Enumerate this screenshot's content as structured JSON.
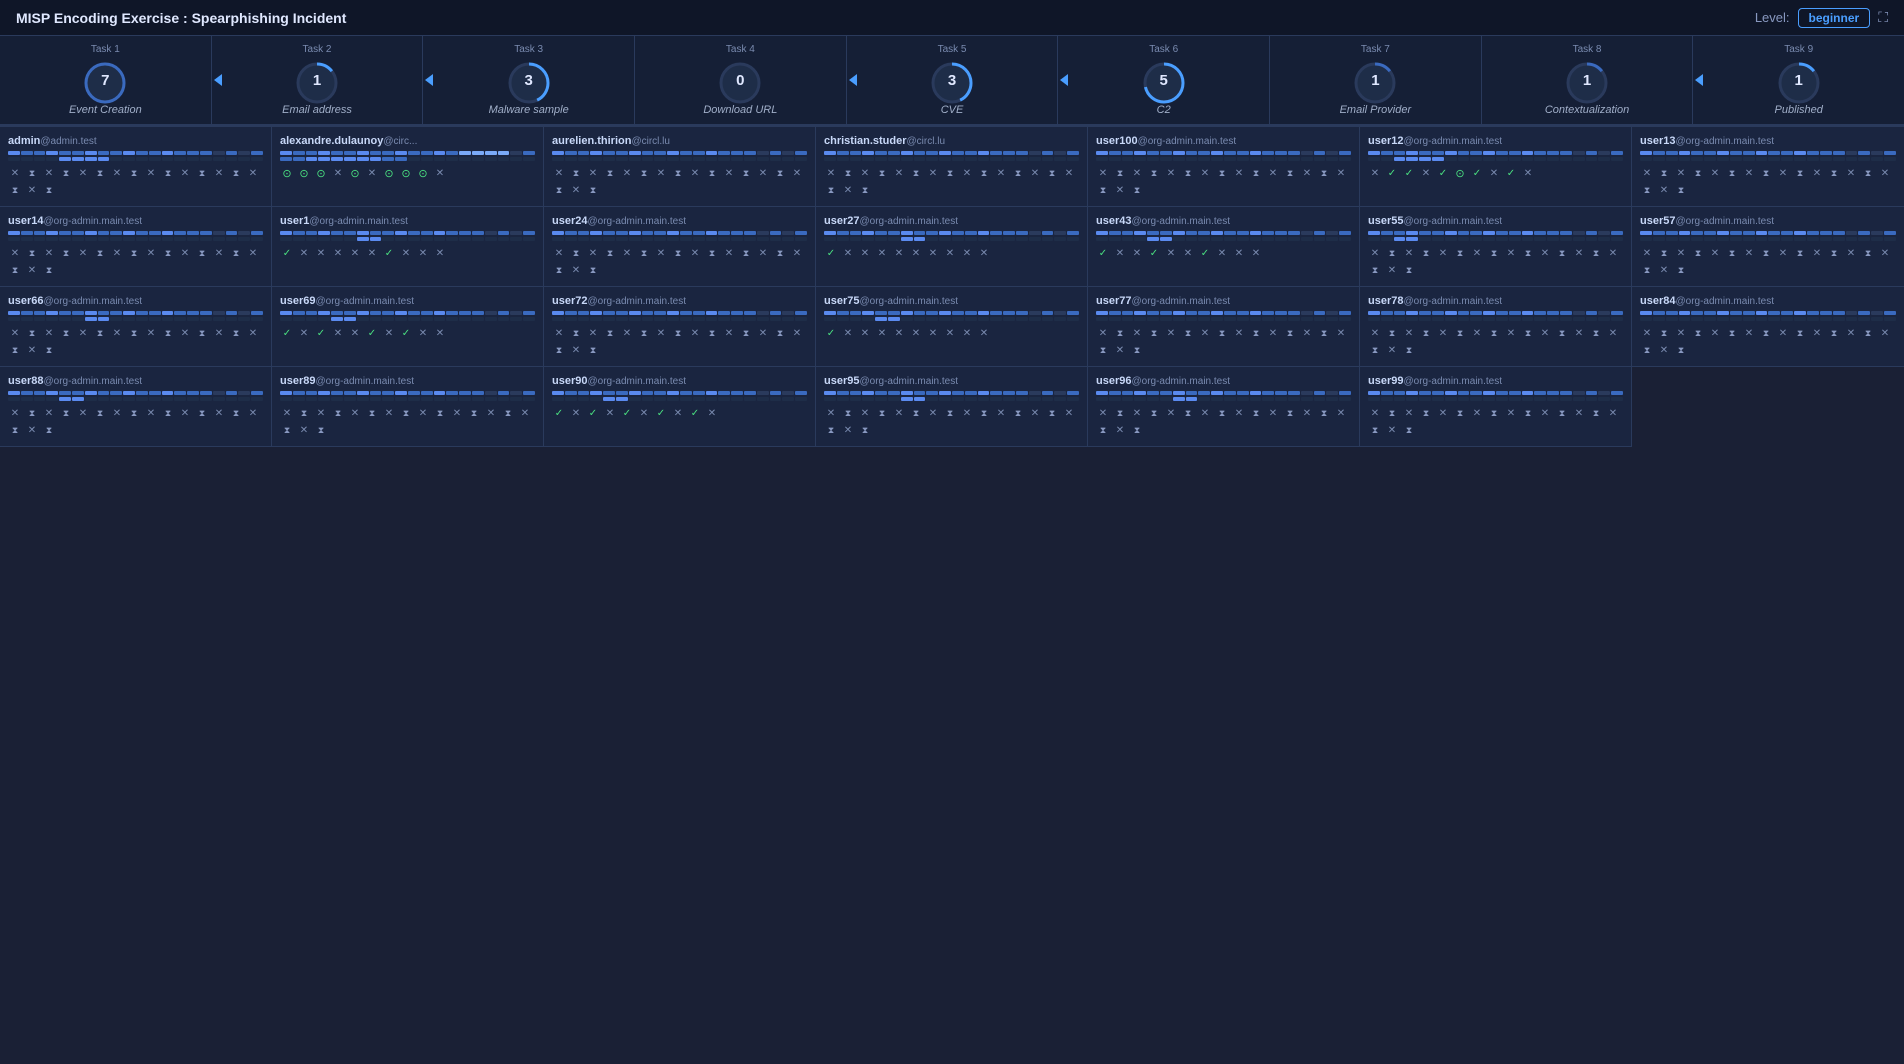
{
  "header": {
    "title": "MISP Encoding Exercise : Spearphishing Incident",
    "level_label": "Level:",
    "level_value": "beginner"
  },
  "tasks": [
    {
      "num": "Task 1",
      "sub": "Event Creation",
      "count": 7,
      "active": true,
      "arrow": false
    },
    {
      "num": "Task 2",
      "sub": "Email address",
      "count": 1,
      "active": false,
      "arrow": true
    },
    {
      "num": "Task 3",
      "sub": "Malware sample",
      "count": 3,
      "active": false,
      "arrow": true
    },
    {
      "num": "Task 4",
      "sub": "Download URL",
      "count": 0,
      "active": false,
      "arrow": false
    },
    {
      "num": "Task 5",
      "sub": "CVE",
      "count": 3,
      "active": false,
      "arrow": true
    },
    {
      "num": "Task 6",
      "sub": "C2",
      "count": 5,
      "active": false,
      "arrow": true
    },
    {
      "num": "Task 7",
      "sub": "Email Provider",
      "count": 1,
      "active": false,
      "arrow": false
    },
    {
      "num": "Task 8",
      "sub": "Contextualization",
      "count": 1,
      "active": false,
      "arrow": false
    },
    {
      "num": "Task 9",
      "sub": "Published",
      "count": 1,
      "active": false,
      "arrow": true
    }
  ],
  "users": [
    {
      "name": "admin",
      "domain": "@admin.test",
      "bars": [
        [
          1,
          1,
          1,
          1,
          1,
          1,
          1,
          1,
          1,
          0
        ],
        [
          0,
          0,
          1,
          1,
          0,
          0,
          0,
          1,
          0,
          0
        ]
      ],
      "icons": [
        "x",
        "h",
        "x",
        "h",
        "x",
        "h",
        "x",
        "h",
        "x",
        "h",
        "x",
        "h",
        "x",
        "h",
        "x",
        "h",
        "x",
        "h"
      ]
    },
    {
      "name": "alexandre.dulaunoy",
      "domain": "@circ...",
      "bars": [
        [
          1,
          1,
          1,
          1,
          1,
          1,
          1,
          1,
          1,
          1
        ],
        [
          0,
          1,
          1,
          1,
          0,
          0,
          1,
          1,
          1,
          0
        ]
      ],
      "icons": [
        "cc",
        "cc",
        "cc",
        "x",
        "cc",
        "x",
        "cc",
        "cc",
        "cc",
        "x"
      ]
    },
    {
      "name": "aurelien.thirion",
      "domain": "@circl.lu",
      "bars": [
        [
          1,
          1,
          1,
          1,
          1,
          1,
          1,
          1,
          1,
          1
        ],
        [
          0,
          0,
          0,
          0,
          0,
          0,
          0,
          0,
          0,
          0
        ]
      ],
      "icons": [
        "x",
        "h",
        "x",
        "h",
        "x",
        "h",
        "x",
        "h",
        "x",
        "h",
        "x",
        "h",
        "x",
        "h",
        "x",
        "h",
        "x",
        "h"
      ]
    },
    {
      "name": "christian.studer",
      "domain": "@circl.lu",
      "bars": [
        [
          1,
          1,
          1,
          1,
          1,
          1,
          1,
          1,
          1,
          1
        ],
        [
          0,
          0,
          0,
          0,
          0,
          0,
          0,
          0,
          0,
          0
        ]
      ],
      "icons": [
        "x",
        "h",
        "x",
        "h",
        "x",
        "h",
        "x",
        "h",
        "x",
        "h",
        "x",
        "h",
        "x",
        "h",
        "x",
        "h",
        "x",
        "h"
      ]
    },
    {
      "name": "user100",
      "domain": "@org-admin.main.test",
      "bars": [
        [
          1,
          1,
          1,
          1,
          1,
          1,
          1,
          1,
          1,
          1
        ],
        [
          0,
          0,
          0,
          0,
          0,
          0,
          0,
          0,
          0,
          0
        ]
      ],
      "icons": [
        "x",
        "h",
        "x",
        "h",
        "x",
        "h",
        "x",
        "h",
        "x",
        "h",
        "x",
        "h",
        "x",
        "h",
        "x",
        "h",
        "x",
        "h"
      ]
    },
    {
      "name": "user12",
      "domain": "@org-admin.main.test",
      "bars": [
        [
          1,
          1,
          1,
          1,
          1,
          1,
          1,
          1,
          1,
          1
        ],
        [
          0,
          1,
          1,
          0,
          1,
          1,
          1,
          1,
          1,
          0
        ]
      ],
      "icons": [
        "x",
        "c",
        "c",
        "x",
        "c",
        "cc",
        "c",
        "x",
        "c",
        "x"
      ]
    },
    {
      "name": "user13",
      "domain": "@org-admin.main.test",
      "bars": [
        [
          1,
          1,
          1,
          1,
          1,
          1,
          1,
          1,
          1,
          1
        ],
        [
          0,
          0,
          0,
          0,
          0,
          0,
          0,
          0,
          0,
          0
        ]
      ],
      "icons": [
        "x",
        "h",
        "x",
        "h",
        "x",
        "h",
        "x",
        "h",
        "x",
        "h",
        "x",
        "h",
        "x",
        "h",
        "x",
        "h",
        "x",
        "h"
      ]
    },
    {
      "name": "user14",
      "domain": "@org-admin.main.test",
      "bars": [
        [
          1,
          1,
          1,
          1,
          1,
          1,
          1,
          1,
          1,
          1
        ],
        [
          0,
          0,
          0,
          0,
          0,
          0,
          0,
          0,
          0,
          0
        ]
      ],
      "icons": [
        "x",
        "h",
        "x",
        "h",
        "x",
        "h",
        "x",
        "h",
        "x",
        "h",
        "x",
        "h",
        "x",
        "h",
        "x",
        "h",
        "x",
        "h"
      ]
    },
    {
      "name": "user1",
      "domain": "@org-admin.main.test",
      "bars": [
        [
          1,
          1,
          1,
          1,
          1,
          1,
          1,
          1,
          1,
          1
        ],
        [
          0,
          0,
          0,
          1,
          1,
          0,
          0,
          0,
          0,
          0
        ]
      ],
      "icons": [
        "c",
        "x",
        "x",
        "x",
        "x",
        "x",
        "c",
        "x",
        "x",
        "x"
      ]
    },
    {
      "name": "user24",
      "domain": "@org-admin.main.test",
      "bars": [
        [
          1,
          1,
          1,
          1,
          1,
          1,
          1,
          1,
          1,
          1
        ],
        [
          0,
          0,
          0,
          0,
          0,
          0,
          0,
          0,
          0,
          0
        ]
      ],
      "icons": [
        "x",
        "h",
        "x",
        "h",
        "x",
        "h",
        "x",
        "h",
        "x",
        "h",
        "x",
        "h",
        "x",
        "h",
        "x",
        "h",
        "x",
        "h"
      ]
    },
    {
      "name": "user27",
      "domain": "@org-admin.main.test",
      "bars": [
        [
          1,
          1,
          1,
          1,
          1,
          1,
          1,
          1,
          1,
          1
        ],
        [
          0,
          0,
          0,
          1,
          0,
          0,
          0,
          0,
          0,
          0
        ]
      ],
      "icons": [
        "c",
        "x",
        "x",
        "x",
        "x",
        "x",
        "x",
        "x",
        "x",
        "x"
      ]
    },
    {
      "name": "user43",
      "domain": "@org-admin.main.test",
      "bars": [
        [
          1,
          1,
          1,
          1,
          1,
          1,
          1,
          1,
          1,
          1
        ],
        [
          0,
          0,
          1,
          0,
          0,
          1,
          0,
          0,
          0,
          0
        ]
      ],
      "icons": [
        "c",
        "x",
        "x",
        "c",
        "x",
        "x",
        "c",
        "x",
        "x",
        "x"
      ]
    },
    {
      "name": "user55",
      "domain": "@org-admin.main.test",
      "bars": [
        [
          1,
          1,
          1,
          1,
          1,
          1,
          1,
          1,
          1,
          1
        ],
        [
          0,
          1,
          0,
          0,
          1,
          0,
          0,
          0,
          0,
          0
        ]
      ],
      "icons": [
        "x",
        "h",
        "x",
        "h",
        "x",
        "h",
        "x",
        "h",
        "x",
        "h",
        "x",
        "h",
        "x",
        "h",
        "x",
        "h",
        "x",
        "h"
      ]
    },
    {
      "name": "user57",
      "domain": "@org-admin.main.test",
      "bars": [
        [
          1,
          1,
          1,
          1,
          1,
          1,
          1,
          1,
          1,
          1
        ],
        [
          0,
          0,
          0,
          0,
          0,
          0,
          0,
          0,
          0,
          0
        ]
      ],
      "icons": [
        "x",
        "h",
        "x",
        "h",
        "x",
        "h",
        "x",
        "h",
        "x",
        "h",
        "x",
        "h",
        "x",
        "h",
        "x",
        "h",
        "x",
        "h"
      ]
    },
    {
      "name": "user66",
      "domain": "@org-admin.main.test",
      "bars": [
        [
          1,
          1,
          1,
          1,
          1,
          1,
          1,
          1,
          1,
          1
        ],
        [
          0,
          0,
          0,
          1,
          0,
          0,
          0,
          0,
          0,
          0
        ]
      ],
      "icons": [
        "x",
        "h",
        "x",
        "h",
        "x",
        "h",
        "x",
        "h",
        "x",
        "h",
        "x",
        "h",
        "x",
        "h",
        "x",
        "h",
        "x",
        "h"
      ]
    },
    {
      "name": "user69",
      "domain": "@org-admin.main.test",
      "bars": [
        [
          1,
          1,
          1,
          1,
          1,
          1,
          1,
          1,
          1,
          1
        ],
        [
          0,
          0,
          1,
          0,
          0,
          1,
          0,
          0,
          0,
          0
        ]
      ],
      "icons": [
        "c",
        "x",
        "c",
        "x",
        "x",
        "c",
        "x",
        "c",
        "x",
        "x"
      ]
    },
    {
      "name": "user72",
      "domain": "@org-admin.main.test",
      "bars": [
        [
          1,
          1,
          1,
          1,
          1,
          1,
          1,
          1,
          1,
          1
        ],
        [
          0,
          0,
          0,
          0,
          0,
          0,
          0,
          0,
          0,
          0
        ]
      ],
      "icons": [
        "x",
        "h",
        "x",
        "h",
        "x",
        "h",
        "x",
        "h",
        "x",
        "h",
        "x",
        "h",
        "x",
        "h",
        "x",
        "h",
        "x",
        "h"
      ]
    },
    {
      "name": "user75",
      "domain": "@org-admin.main.test",
      "bars": [
        [
          1,
          1,
          1,
          1,
          1,
          1,
          1,
          1,
          1,
          1
        ],
        [
          0,
          0,
          1,
          0,
          0,
          0,
          0,
          0,
          0,
          0
        ]
      ],
      "icons": [
        "c",
        "x",
        "x",
        "x",
        "x",
        "x",
        "x",
        "x",
        "x",
        "x"
      ]
    },
    {
      "name": "user77",
      "domain": "@org-admin.main.test",
      "bars": [
        [
          1,
          1,
          1,
          1,
          1,
          1,
          1,
          1,
          1,
          1
        ],
        [
          0,
          0,
          0,
          0,
          0,
          0,
          0,
          0,
          0,
          0
        ]
      ],
      "icons": [
        "x",
        "h",
        "x",
        "h",
        "x",
        "h",
        "x",
        "h",
        "x",
        "h",
        "x",
        "h",
        "x",
        "h",
        "x",
        "h",
        "x",
        "h"
      ]
    },
    {
      "name": "user78",
      "domain": "@org-admin.main.test",
      "bars": [
        [
          1,
          1,
          1,
          1,
          1,
          1,
          1,
          1,
          1,
          1
        ],
        [
          0,
          0,
          0,
          0,
          0,
          0,
          0,
          0,
          0,
          0
        ]
      ],
      "icons": [
        "x",
        "h",
        "x",
        "h",
        "x",
        "h",
        "x",
        "h",
        "x",
        "h",
        "x",
        "h",
        "x",
        "h",
        "x",
        "h",
        "x",
        "h"
      ]
    },
    {
      "name": "user84",
      "domain": "@org-admin.main.test",
      "bars": [
        [
          1,
          1,
          1,
          1,
          1,
          1,
          1,
          1,
          1,
          1
        ],
        [
          0,
          0,
          0,
          0,
          0,
          0,
          0,
          0,
          0,
          0
        ]
      ],
      "icons": [
        "x",
        "h",
        "x",
        "h",
        "x",
        "h",
        "x",
        "h",
        "x",
        "h",
        "x",
        "h",
        "x",
        "h",
        "x",
        "h",
        "x",
        "h"
      ]
    },
    {
      "name": "user88",
      "domain": "@org-admin.main.test",
      "bars": [
        [
          1,
          1,
          1,
          1,
          1,
          1,
          1,
          1,
          1,
          1
        ],
        [
          0,
          0,
          1,
          0,
          0,
          0,
          0,
          0,
          0,
          0
        ]
      ],
      "icons": [
        "x",
        "h",
        "x",
        "h",
        "x",
        "h",
        "x",
        "h",
        "x",
        "h",
        "x",
        "h",
        "x",
        "h",
        "x",
        "h",
        "x",
        "h"
      ]
    },
    {
      "name": "user89",
      "domain": "@org-admin.main.test",
      "bars": [
        [
          1,
          1,
          1,
          1,
          1,
          1,
          1,
          1,
          1,
          1
        ],
        [
          0,
          0,
          0,
          0,
          0,
          0,
          0,
          0,
          0,
          0
        ]
      ],
      "icons": [
        "x",
        "h",
        "x",
        "h",
        "x",
        "h",
        "x",
        "h",
        "x",
        "h",
        "x",
        "h",
        "x",
        "h",
        "x",
        "h",
        "x",
        "h"
      ]
    },
    {
      "name": "user90",
      "domain": "@org-admin.main.test",
      "bars": [
        [
          1,
          1,
          1,
          1,
          1,
          1,
          1,
          1,
          1,
          1
        ],
        [
          0,
          0,
          1,
          0,
          0,
          1,
          0,
          0,
          1,
          0
        ]
      ],
      "icons": [
        "c",
        "x",
        "c",
        "x",
        "c",
        "x",
        "c",
        "x",
        "c",
        "x"
      ]
    },
    {
      "name": "user95",
      "domain": "@org-admin.main.test",
      "bars": [
        [
          1,
          1,
          1,
          1,
          1,
          1,
          1,
          1,
          1,
          1
        ],
        [
          0,
          0,
          0,
          1,
          0,
          0,
          0,
          0,
          0,
          0
        ]
      ],
      "icons": [
        "x",
        "h",
        "x",
        "h",
        "x",
        "h",
        "x",
        "h",
        "x",
        "h",
        "x",
        "h",
        "x",
        "h",
        "x",
        "h",
        "x",
        "h"
      ]
    },
    {
      "name": "user96",
      "domain": "@org-admin.main.test",
      "bars": [
        [
          1,
          1,
          1,
          1,
          1,
          1,
          1,
          1,
          1,
          1
        ],
        [
          0,
          0,
          0,
          1,
          1,
          0,
          0,
          0,
          0,
          0
        ]
      ],
      "icons": [
        "x",
        "h",
        "x",
        "h",
        "x",
        "h",
        "x",
        "h",
        "x",
        "h",
        "x",
        "h",
        "x",
        "h",
        "x",
        "h",
        "x",
        "h"
      ]
    },
    {
      "name": "user99",
      "domain": "@org-admin.main.test",
      "bars": [
        [
          1,
          1,
          1,
          1,
          1,
          1,
          1,
          1,
          1,
          1
        ],
        [
          0,
          0,
          0,
          0,
          0,
          0,
          0,
          0,
          0,
          0
        ]
      ],
      "icons": [
        "x",
        "h",
        "x",
        "h",
        "x",
        "h",
        "x",
        "h",
        "x",
        "h",
        "x",
        "h",
        "x",
        "h",
        "x",
        "h",
        "x",
        "h"
      ]
    }
  ]
}
